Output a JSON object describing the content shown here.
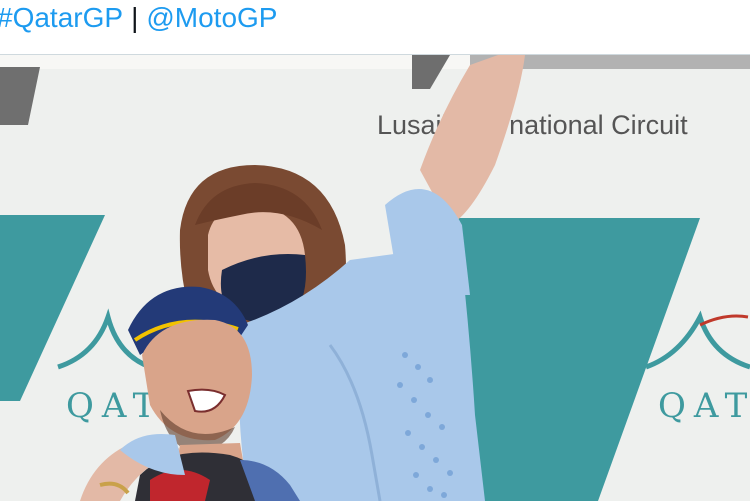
{
  "tweet": {
    "hashtag": "#QatarGP",
    "separator": "|",
    "mention": "@MotoGP"
  },
  "photo": {
    "backdrop_text": "Lusail International Circuit",
    "backdrop_logo_text": "QATAR",
    "colors": {
      "teal": "#3e9a9f",
      "shirt": "#a9c8ea",
      "backdrop": "#eef0ee",
      "link": "#1d9bf0"
    }
  }
}
